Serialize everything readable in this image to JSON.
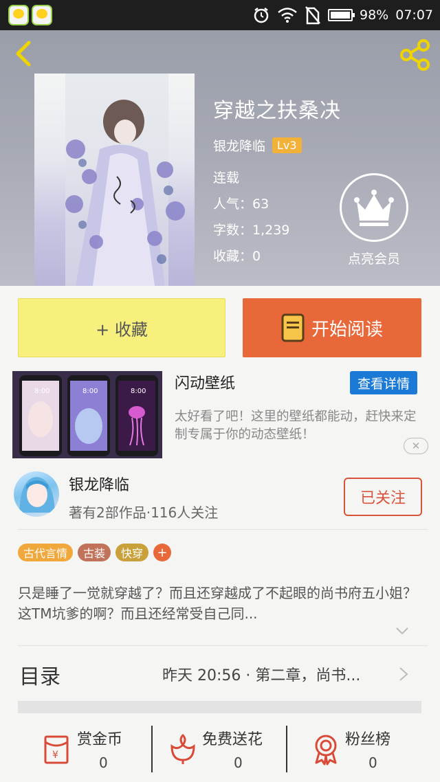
{
  "status_bar": {
    "battery": "98%",
    "time": "07:07"
  },
  "book": {
    "title": "穿越之扶桑决",
    "author": "银龙降临",
    "level": "Lv3",
    "status": "连载",
    "popularity": "人气：63",
    "word_count": "字数：1,239",
    "favorites": "收藏：0"
  },
  "vip": {
    "label": "点亮会员"
  },
  "actions": {
    "collect": "+ 收藏",
    "read": "开始阅读"
  },
  "ad": {
    "title": "闪动壁纸",
    "detail_button": "查看详情",
    "description": "太好看了吧！这里的壁纸都能动，赶快来定制专属于你的动态壁纸！",
    "phone_time": "8:00"
  },
  "author_info": {
    "name": "银龙降临",
    "stats": "著有2部作品·116人关注",
    "follow_button": "已关注"
  },
  "tags": [
    {
      "label": "古代言情",
      "color": "#f0a83c"
    },
    {
      "label": "古装",
      "color": "#c0725a"
    },
    {
      "label": "快穿",
      "color": "#c9a03a"
    }
  ],
  "tag_more": "+",
  "summary": "只是睡了一觉就穿越了？而且还穿越成了不起眼的尚书府五小姐？这TM坑爹的啊？而且还经常受自己同...",
  "toc": {
    "label": "目录",
    "latest": "昨天 20:56 · 第二章，尚书..."
  },
  "bottom_bar": [
    {
      "label": "赏金币",
      "count": "0",
      "icon": "red-envelope-icon"
    },
    {
      "label": "免费送花",
      "count": "0",
      "icon": "flower-icon"
    },
    {
      "label": "粉丝榜",
      "count": "0",
      "icon": "medal-icon"
    }
  ],
  "colors": {
    "accent": "#e8683a",
    "collect": "#f8f07d",
    "link_blue": "#1a7ad6",
    "follow_red": "#d9533b"
  }
}
